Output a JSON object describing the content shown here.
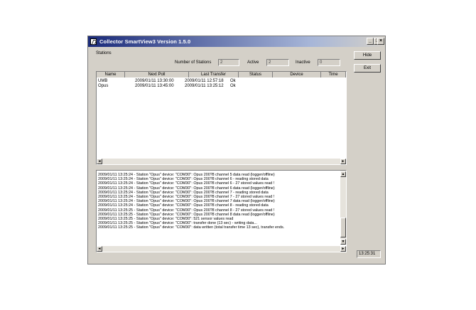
{
  "window": {
    "title": "Collector SmartView3 Version 1.5.0",
    "min_glyph": "_",
    "max_glyph": "□",
    "close_glyph": "×"
  },
  "stations": {
    "group_label": "Stations",
    "number_label": "Number of Stations",
    "number_value": "2",
    "active_label": "Active",
    "active_value": "2",
    "inactive_label": "Inactive",
    "inactive_value": "0"
  },
  "buttons": {
    "hide": "Hide",
    "exit": "Exit"
  },
  "table": {
    "columns": [
      "Name",
      "Next Poll",
      "Last Transfer",
      "Status",
      "Device",
      "Time"
    ],
    "rows": [
      [
        "UMB",
        "2009/01/11 13:30:00",
        "2009/01/11 12:57:18",
        "Ok",
        "",
        ""
      ],
      [
        "Opus",
        "2009/01/11 13:45:00",
        "2009/01/11 13:25:12",
        "Ok",
        "",
        ""
      ]
    ]
  },
  "scroll": {
    "left": "◄",
    "right": "►",
    "up": "▲",
    "down": "▼"
  },
  "log": [
    "2009/01/11 13:25:24 - Station \"Opus\" device: \"COM30\": Opus 200?8 channel 5 data read (logger/offline)",
    "2009/01/11 13:25:24 - Station \"Opus\" device: \"COM30\": Opus 200?8 channel 6 - reading stored data",
    "2009/01/11 13:25:24 - Station \"Opus\" device: \"COM30\": Opus 200?8 channel 6 - 27 stored values read !",
    "2009/01/11 13:25:24 - Station \"Opus\" device: \"COM30\": Opus 200?8 channel 6 data read (logger/offline)",
    "2009/01/11 13:25:24 - Station \"Opus\" device: \"COM30\": Opus 200?8 channel 7 - reading stored data",
    "2009/01/11 13:25:24 - Station \"Opus\" device: \"COM30\": Opus 200?8 channel 7 - 27 stored values read !",
    "2009/01/11 13:25:24 - Station \"Opus\" device: \"COM30\": Opus 200?8 channel 7 data read (logger/offline)",
    "2009/01/11 13:25:24 - Station \"Opus\" device: \"COM30\": Opus 200?8 channel 8 - reading stored data",
    "2009/01/11 13:25:25 - Station \"Opus\" device: \"COM30\": Opus 200?8 channel 8 - 27 stored values read !",
    "2009/01/11 13:25:25 - Station \"Opus\" device: \"COM30\": Opus 200?8 channel 8 data read (logger/offline)",
    "2009/01/11 13:25:25 - Station \"Opus\" device: \"COM30\": 521 sensor values read",
    "2009/01/11 13:25:25 - Station \"Opus\" device: \"COM30\": transfer done (13 sec) - writing data...",
    "2009/01/11 13:25:25 - Station \"Opus\" device: \"COM30\": data written (total transfer time 13 sec), transfer ends."
  ],
  "clock": "13:25:31"
}
